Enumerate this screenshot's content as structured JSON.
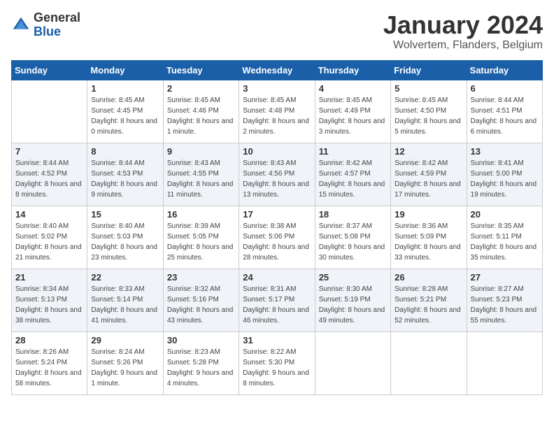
{
  "logo": {
    "line1": "General",
    "line2": "Blue"
  },
  "title": "January 2024",
  "subtitle": "Wolvertem, Flanders, Belgium",
  "weekdays": [
    "Sunday",
    "Monday",
    "Tuesday",
    "Wednesday",
    "Thursday",
    "Friday",
    "Saturday"
  ],
  "weeks": [
    [
      {
        "day": "",
        "sunrise": "",
        "sunset": "",
        "daylight": ""
      },
      {
        "day": "1",
        "sunrise": "Sunrise: 8:45 AM",
        "sunset": "Sunset: 4:45 PM",
        "daylight": "Daylight: 8 hours and 0 minutes."
      },
      {
        "day": "2",
        "sunrise": "Sunrise: 8:45 AM",
        "sunset": "Sunset: 4:46 PM",
        "daylight": "Daylight: 8 hours and 1 minute."
      },
      {
        "day": "3",
        "sunrise": "Sunrise: 8:45 AM",
        "sunset": "Sunset: 4:48 PM",
        "daylight": "Daylight: 8 hours and 2 minutes."
      },
      {
        "day": "4",
        "sunrise": "Sunrise: 8:45 AM",
        "sunset": "Sunset: 4:49 PM",
        "daylight": "Daylight: 8 hours and 3 minutes."
      },
      {
        "day": "5",
        "sunrise": "Sunrise: 8:45 AM",
        "sunset": "Sunset: 4:50 PM",
        "daylight": "Daylight: 8 hours and 5 minutes."
      },
      {
        "day": "6",
        "sunrise": "Sunrise: 8:44 AM",
        "sunset": "Sunset: 4:51 PM",
        "daylight": "Daylight: 8 hours and 6 minutes."
      }
    ],
    [
      {
        "day": "7",
        "sunrise": "Sunrise: 8:44 AM",
        "sunset": "Sunset: 4:52 PM",
        "daylight": "Daylight: 8 hours and 8 minutes."
      },
      {
        "day": "8",
        "sunrise": "Sunrise: 8:44 AM",
        "sunset": "Sunset: 4:53 PM",
        "daylight": "Daylight: 8 hours and 9 minutes."
      },
      {
        "day": "9",
        "sunrise": "Sunrise: 8:43 AM",
        "sunset": "Sunset: 4:55 PM",
        "daylight": "Daylight: 8 hours and 11 minutes."
      },
      {
        "day": "10",
        "sunrise": "Sunrise: 8:43 AM",
        "sunset": "Sunset: 4:56 PM",
        "daylight": "Daylight: 8 hours and 13 minutes."
      },
      {
        "day": "11",
        "sunrise": "Sunrise: 8:42 AM",
        "sunset": "Sunset: 4:57 PM",
        "daylight": "Daylight: 8 hours and 15 minutes."
      },
      {
        "day": "12",
        "sunrise": "Sunrise: 8:42 AM",
        "sunset": "Sunset: 4:59 PM",
        "daylight": "Daylight: 8 hours and 17 minutes."
      },
      {
        "day": "13",
        "sunrise": "Sunrise: 8:41 AM",
        "sunset": "Sunset: 5:00 PM",
        "daylight": "Daylight: 8 hours and 19 minutes."
      }
    ],
    [
      {
        "day": "14",
        "sunrise": "Sunrise: 8:40 AM",
        "sunset": "Sunset: 5:02 PM",
        "daylight": "Daylight: 8 hours and 21 minutes."
      },
      {
        "day": "15",
        "sunrise": "Sunrise: 8:40 AM",
        "sunset": "Sunset: 5:03 PM",
        "daylight": "Daylight: 8 hours and 23 minutes."
      },
      {
        "day": "16",
        "sunrise": "Sunrise: 8:39 AM",
        "sunset": "Sunset: 5:05 PM",
        "daylight": "Daylight: 8 hours and 25 minutes."
      },
      {
        "day": "17",
        "sunrise": "Sunrise: 8:38 AM",
        "sunset": "Sunset: 5:06 PM",
        "daylight": "Daylight: 8 hours and 28 minutes."
      },
      {
        "day": "18",
        "sunrise": "Sunrise: 8:37 AM",
        "sunset": "Sunset: 5:08 PM",
        "daylight": "Daylight: 8 hours and 30 minutes."
      },
      {
        "day": "19",
        "sunrise": "Sunrise: 8:36 AM",
        "sunset": "Sunset: 5:09 PM",
        "daylight": "Daylight: 8 hours and 33 minutes."
      },
      {
        "day": "20",
        "sunrise": "Sunrise: 8:35 AM",
        "sunset": "Sunset: 5:11 PM",
        "daylight": "Daylight: 8 hours and 35 minutes."
      }
    ],
    [
      {
        "day": "21",
        "sunrise": "Sunrise: 8:34 AM",
        "sunset": "Sunset: 5:13 PM",
        "daylight": "Daylight: 8 hours and 38 minutes."
      },
      {
        "day": "22",
        "sunrise": "Sunrise: 8:33 AM",
        "sunset": "Sunset: 5:14 PM",
        "daylight": "Daylight: 8 hours and 41 minutes."
      },
      {
        "day": "23",
        "sunrise": "Sunrise: 8:32 AM",
        "sunset": "Sunset: 5:16 PM",
        "daylight": "Daylight: 8 hours and 43 minutes."
      },
      {
        "day": "24",
        "sunrise": "Sunrise: 8:31 AM",
        "sunset": "Sunset: 5:17 PM",
        "daylight": "Daylight: 8 hours and 46 minutes."
      },
      {
        "day": "25",
        "sunrise": "Sunrise: 8:30 AM",
        "sunset": "Sunset: 5:19 PM",
        "daylight": "Daylight: 8 hours and 49 minutes."
      },
      {
        "day": "26",
        "sunrise": "Sunrise: 8:28 AM",
        "sunset": "Sunset: 5:21 PM",
        "daylight": "Daylight: 8 hours and 52 minutes."
      },
      {
        "day": "27",
        "sunrise": "Sunrise: 8:27 AM",
        "sunset": "Sunset: 5:23 PM",
        "daylight": "Daylight: 8 hours and 55 minutes."
      }
    ],
    [
      {
        "day": "28",
        "sunrise": "Sunrise: 8:26 AM",
        "sunset": "Sunset: 5:24 PM",
        "daylight": "Daylight: 8 hours and 58 minutes."
      },
      {
        "day": "29",
        "sunrise": "Sunrise: 8:24 AM",
        "sunset": "Sunset: 5:26 PM",
        "daylight": "Daylight: 9 hours and 1 minute."
      },
      {
        "day": "30",
        "sunrise": "Sunrise: 8:23 AM",
        "sunset": "Sunset: 5:28 PM",
        "daylight": "Daylight: 9 hours and 4 minutes."
      },
      {
        "day": "31",
        "sunrise": "Sunrise: 8:22 AM",
        "sunset": "Sunset: 5:30 PM",
        "daylight": "Daylight: 9 hours and 8 minutes."
      },
      {
        "day": "",
        "sunrise": "",
        "sunset": "",
        "daylight": ""
      },
      {
        "day": "",
        "sunrise": "",
        "sunset": "",
        "daylight": ""
      },
      {
        "day": "",
        "sunrise": "",
        "sunset": "",
        "daylight": ""
      }
    ]
  ]
}
